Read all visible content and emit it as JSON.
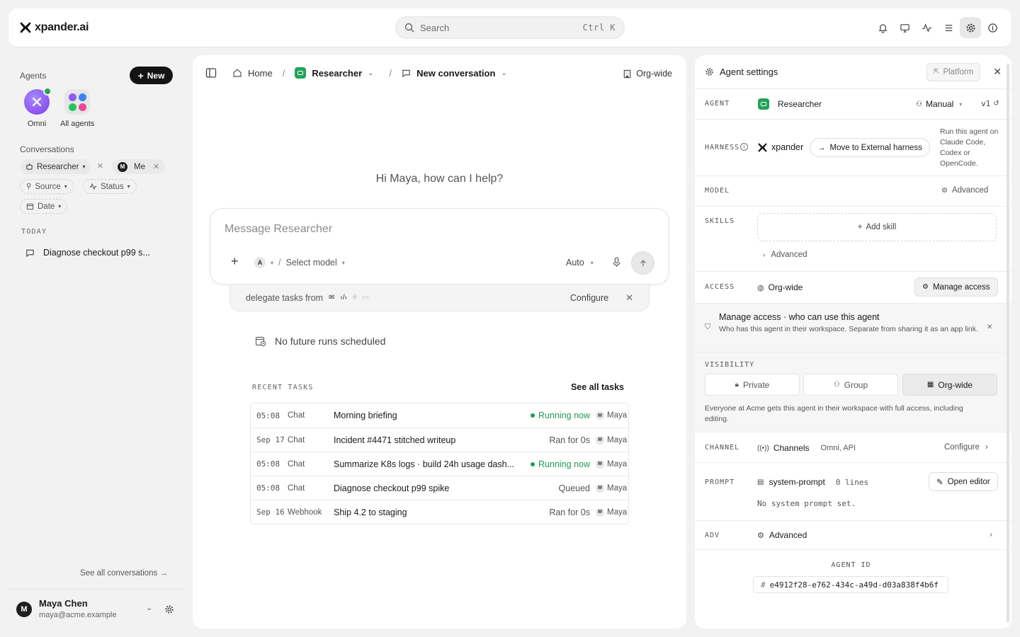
{
  "app": {
    "name": "xpander.ai"
  },
  "search": {
    "placeholder": "Search",
    "shortcut": "Ctrl K"
  },
  "top_icons": [
    "bell-icon",
    "monitor-icon",
    "activity-icon",
    "menu-icon",
    "gear-icon",
    "info-icon"
  ],
  "sidebar": {
    "agents_title": "Agents",
    "new_label": "New",
    "agents": [
      {
        "name": "Omni"
      },
      {
        "name": "All agents"
      }
    ],
    "conversations_title": "Conversations",
    "filters": {
      "agent": "Researcher",
      "user": "Me",
      "user_initial": "M",
      "source": "Source",
      "status": "Status",
      "date": "Date"
    },
    "today_label": "TODAY",
    "conversation_items": [
      "Diagnose checkout p99 s..."
    ],
    "see_all": "See all conversations →",
    "user": {
      "name": "Maya Chen",
      "email": "maya@acme.example",
      "initial": "M"
    }
  },
  "center": {
    "breadcrumb": {
      "home": "Home",
      "agent": "Researcher",
      "conversation": "New conversation"
    },
    "scope": "Org-wide",
    "greeting": "Hi Maya, how can I help?",
    "composer": {
      "placeholder": "Message Researcher",
      "model_avatar": "A",
      "model": "Select model",
      "mode": "Auto"
    },
    "delegate": {
      "text": "delegate tasks from",
      "configure": "Configure"
    },
    "no_future": "No future runs scheduled",
    "recent_label": "RECENT TASKS",
    "see_all_tasks": "See all tasks",
    "tasks": [
      {
        "time": "05:08",
        "kind": "Chat",
        "name": "Morning briefing",
        "status": "Running now",
        "running": true,
        "user": "Maya"
      },
      {
        "time": "Sep 17",
        "kind": "Chat",
        "name": "Incident #4471 stitched writeup",
        "status": "Ran for 0s",
        "running": false,
        "user": "Maya"
      },
      {
        "time": "05:08",
        "kind": "Chat",
        "name": "Summarize K8s logs · build 24h usage dash...",
        "status": "Running now",
        "running": true,
        "user": "Maya"
      },
      {
        "time": "05:08",
        "kind": "Chat",
        "name": "Diagnose checkout p99 spike",
        "status": "Queued",
        "running": false,
        "user": "Maya"
      },
      {
        "time": "Sep 16",
        "kind": "Webhook",
        "name": "Ship 4.2 to staging",
        "status": "Ran for 0s",
        "running": false,
        "user": "Maya"
      }
    ]
  },
  "panel": {
    "title": "Agent settings",
    "platform": "Platform",
    "agent": {
      "label": "AGENT",
      "name": "Researcher",
      "mode": "Manual",
      "version": "v1"
    },
    "harness": {
      "label": "HARNESS",
      "name": "xpander",
      "button": "Move to External harness",
      "note": "Run this agent on Claude Code, Codex or OpenCode."
    },
    "model": {
      "label": "MODEL",
      "value": "Advanced"
    },
    "skills": {
      "label": "SKILLS",
      "add": "Add skill",
      "advanced": "Advanced"
    },
    "access": {
      "label": "ACCESS",
      "value": "Org-wide",
      "button": "Manage access",
      "info_title": "Manage access · who can use this agent",
      "info_text": "Who has this agent in their workspace. Separate from sharing it as an app link."
    },
    "visibility": {
      "label": "VISIBILITY",
      "options": [
        "Private",
        "Group",
        "Org-wide"
      ],
      "selected": "Org-wide",
      "note": "Everyone at Acme gets this agent in their workspace with full access, including editing."
    },
    "channel": {
      "label": "CHANNEL",
      "name": "Channels",
      "value": "Omni, API",
      "configure": "Configure"
    },
    "prompt": {
      "label": "PROMPT",
      "name": "system-prompt",
      "lines": "0 lines",
      "button": "Open editor",
      "empty": "No system prompt set."
    },
    "adv": {
      "label": "ADV",
      "value": "Advanced"
    },
    "agent_id": {
      "label": "AGENT ID",
      "value": "e4912f28-e762-434c-a49d-d03a838f4b6f"
    }
  },
  "colors": {
    "accent_dark": "#141414",
    "running_green": "#1f9a57",
    "omni_purple": "#8b5cf6"
  }
}
